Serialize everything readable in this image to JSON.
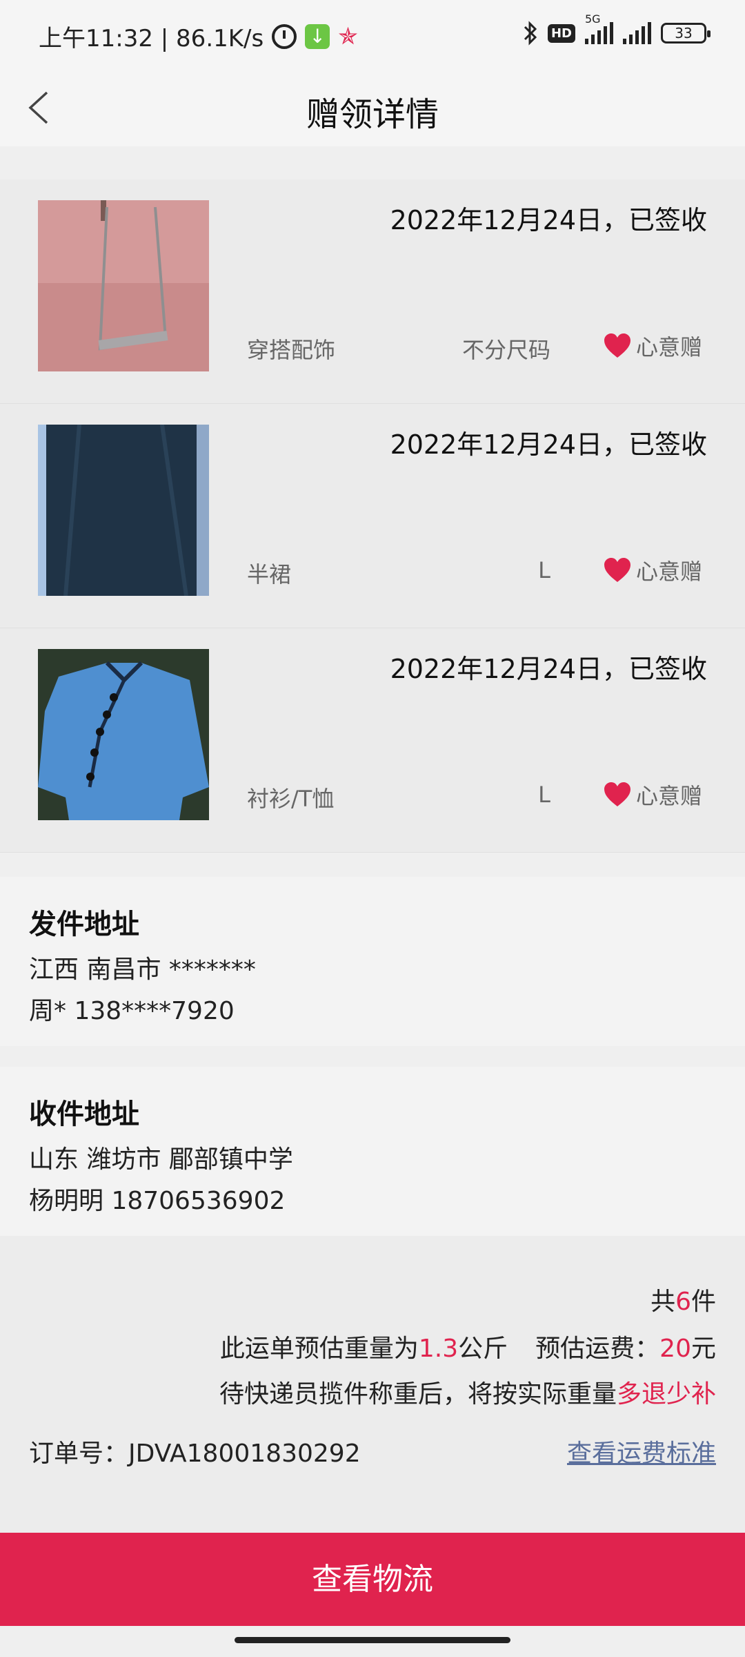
{
  "status_bar": {
    "time_speed": "上午11:32 | 86.1K/s",
    "network": "5G",
    "hd": "HD",
    "battery": "33"
  },
  "header": {
    "title": "赠领详情"
  },
  "goods": [
    {
      "date_status": "2022年12月24日，已签收",
      "category": "穿搭配饰",
      "size": "不分尺码",
      "tag": "心意赠"
    },
    {
      "date_status": "2022年12月24日，已签收",
      "category": "半裙",
      "size": "L",
      "tag": "心意赠"
    },
    {
      "date_status": "2022年12月24日，已签收",
      "category": "衬衫/T恤",
      "size": "L",
      "tag": "心意赠"
    }
  ],
  "sender": {
    "title": "发件地址",
    "address": "江西 南昌市 *******",
    "contact": "周* 138****7920"
  },
  "receiver": {
    "title": "收件地址",
    "address": "山东 潍坊市 郿部镇中学",
    "contact": "杨明明 18706536902"
  },
  "summary": {
    "total_prefix": "共",
    "total_count": "6",
    "total_suffix": "件",
    "weight_prefix": "此运单预估重量为",
    "weight_value": "1.3",
    "weight_unit": "公斤",
    "fee_prefix": "预估运费：",
    "fee_value": "20",
    "fee_unit": "元",
    "note_prefix": "待快递员揽件称重后，将按实际重量",
    "note_highlight": "多退少补",
    "order_no": "订单号：JDVA18001830292",
    "fee_standard_link": "查看运费标准"
  },
  "bottom_button": {
    "label": "查看物流"
  },
  "colors": {
    "accent": "#e0234e",
    "link": "#5a6e9c"
  }
}
